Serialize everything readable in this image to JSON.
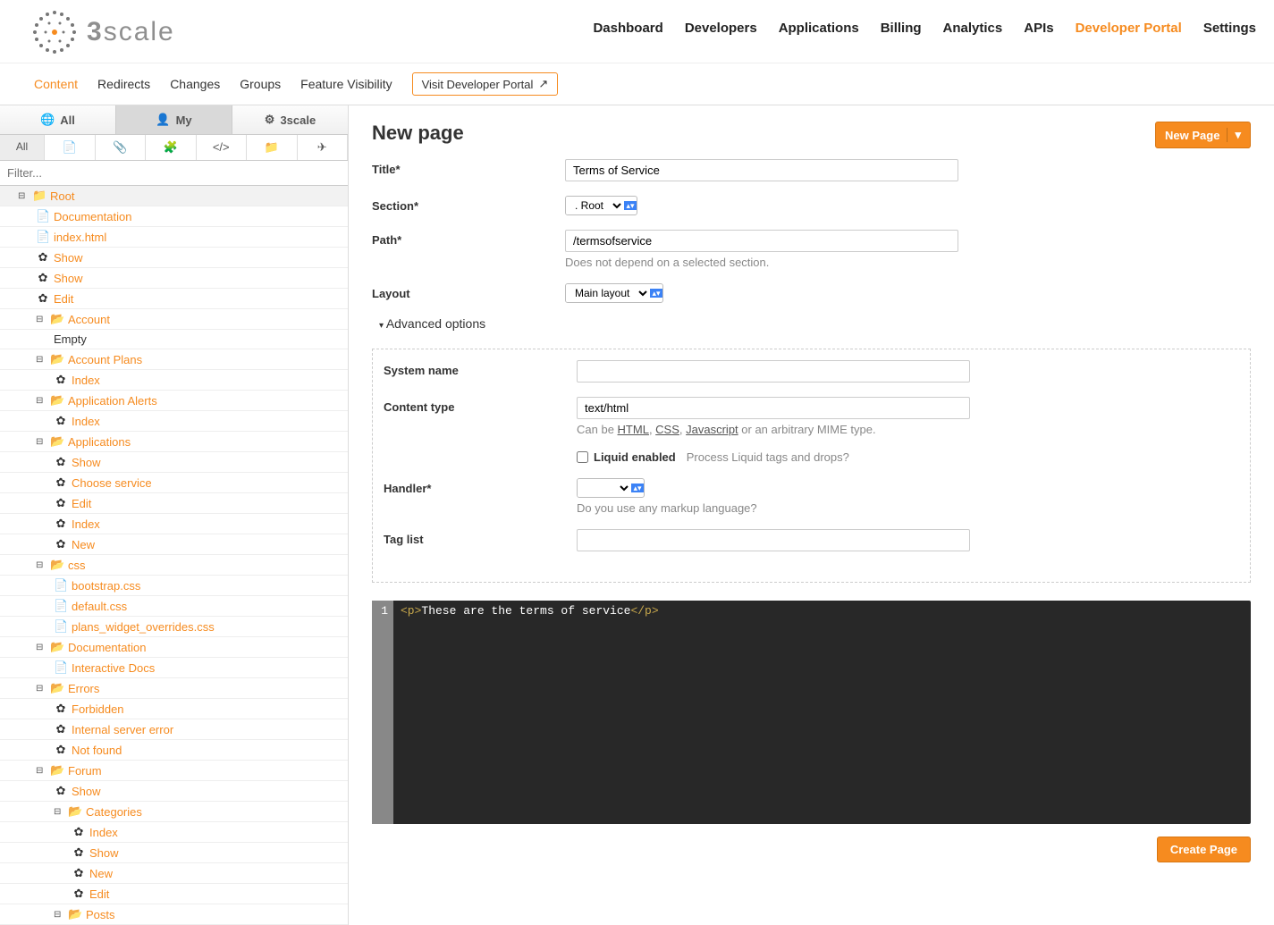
{
  "logo_text_prefix": "3",
  "logo_text_suffix": "scale",
  "main_nav": {
    "dashboard": "Dashboard",
    "developers": "Developers",
    "applications": "Applications",
    "billing": "Billing",
    "analytics": "Analytics",
    "apis": "APIs",
    "developer_portal": "Developer Portal",
    "settings": "Settings"
  },
  "sub_nav": {
    "content": "Content",
    "redirects": "Redirects",
    "changes": "Changes",
    "groups": "Groups",
    "feature_visibility": "Feature Visibility",
    "visit_btn": "Visit Developer Portal"
  },
  "side_tabs": {
    "all": "All",
    "my": "My",
    "threescale": "3scale"
  },
  "filter_all": "All",
  "filter_placeholder": "Filter...",
  "tree": {
    "root": "Root",
    "documentation_top": "Documentation",
    "index_html": "index.html",
    "show1": "Show",
    "show2": "Show",
    "edit_top": "Edit",
    "account": "Account",
    "empty": "Empty",
    "account_plans": "Account Plans",
    "account_plans_index": "Index",
    "application_alerts": "Application Alerts",
    "application_alerts_index": "Index",
    "applications": "Applications",
    "applications_show": "Show",
    "choose_service": "Choose service",
    "applications_edit": "Edit",
    "applications_index": "Index",
    "applications_new": "New",
    "css": "css",
    "bootstrap_css": "bootstrap.css",
    "default_css": "default.css",
    "plans_widget_css": "plans_widget_overrides.css",
    "documentation": "Documentation",
    "interactive_docs": "Interactive Docs",
    "errors": "Errors",
    "forbidden": "Forbidden",
    "internal_server_error": "Internal server error",
    "not_found": "Not found",
    "forum": "Forum",
    "forum_show": "Show",
    "categories": "Categories",
    "cat_index": "Index",
    "cat_show": "Show",
    "cat_new": "New",
    "cat_edit": "Edit",
    "posts": "Posts"
  },
  "page": {
    "title": "New page",
    "new_page_btn": "New Page",
    "labels": {
      "title": "Title*",
      "section": "Section*",
      "path": "Path*",
      "layout": "Layout",
      "advanced": "Advanced options",
      "system_name": "System name",
      "content_type": "Content type",
      "liquid_enabled": "Liquid enabled",
      "handler": "Handler*",
      "tag_list": "Tag list"
    },
    "values": {
      "title": "Terms of Service",
      "section": ". Root",
      "path": "/termsofservice",
      "layout": "Main layout",
      "system_name": "",
      "content_type": "text/html",
      "handler": "",
      "tag_list": ""
    },
    "help": {
      "path": "Does not depend on a selected section.",
      "content_type_prefix": "Can be ",
      "content_type_html": "HTML",
      "content_type_sep1": ", ",
      "content_type_css": "CSS",
      "content_type_sep2": ", ",
      "content_type_js": "Javascript",
      "content_type_suffix": " or an arbitrary MIME type.",
      "liquid": "Process Liquid tags and drops?",
      "handler": "Do you use any markup language?"
    },
    "editor": {
      "line_no": "1",
      "open_tag": "<p>",
      "content": "These are the terms of service",
      "close_tag": "</p>"
    },
    "create_btn": "Create Page"
  }
}
